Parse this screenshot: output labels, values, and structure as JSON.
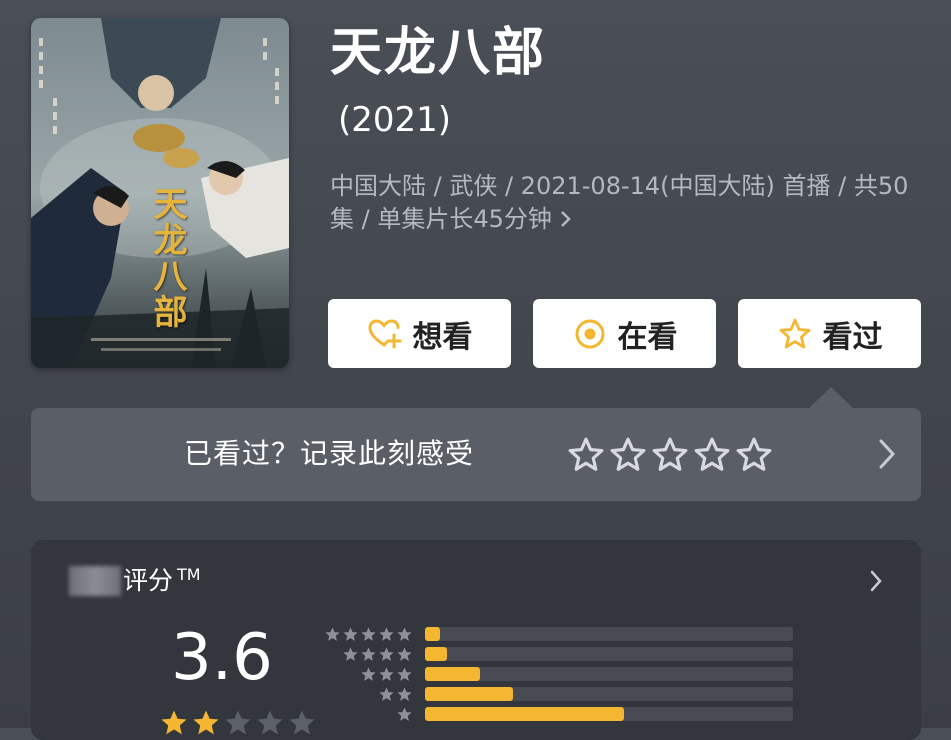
{
  "poster": {
    "title_text": "天龙八部"
  },
  "show": {
    "title": "天龙八部",
    "year": "(2021)",
    "meta": "中国大陆 / 武侠 / 2021-08-14(中国大陆) 首播 / 共50集 / 单集片长45分钟"
  },
  "actions": {
    "want_label": "想看",
    "watching_label": "在看",
    "watched_label": "看过"
  },
  "record": {
    "prompt": "已看过？记录此刻感受",
    "star_count": 5
  },
  "rating": {
    "label_suffix": "评分",
    "trademark": "TM",
    "score": "3.6",
    "score_stars": 2,
    "distribution": [
      {
        "stars": 5,
        "fraction": 0.04
      },
      {
        "stars": 4,
        "fraction": 0.06
      },
      {
        "stars": 3,
        "fraction": 0.15
      },
      {
        "stars": 2,
        "fraction": 0.24
      },
      {
        "stars": 1,
        "fraction": 0.54
      }
    ]
  },
  "colors": {
    "accent": "#f5b731",
    "background": "#454950",
    "card": "#33363d"
  },
  "icons": {
    "want": "heart-plus-icon",
    "watching": "target-circle-icon",
    "watched": "star-outline-icon"
  }
}
